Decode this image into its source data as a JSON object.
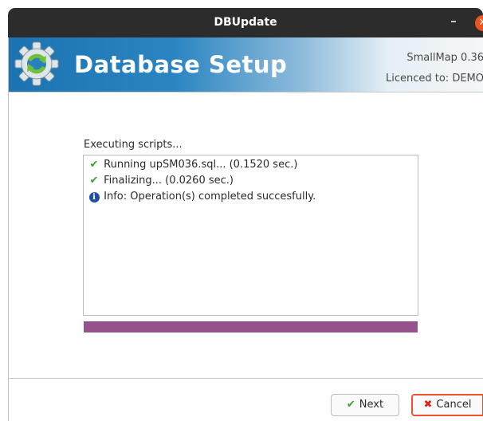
{
  "window": {
    "title": "DBUpdate",
    "minimize_glyph": "–",
    "close_glyph": "✕"
  },
  "header": {
    "title": "Database Setup",
    "product": "SmallMap 0.36",
    "licence": "Licenced to: DEMO",
    "logo_icon": "gear-refresh-icon"
  },
  "main": {
    "section_label": "Executing scripts...",
    "log": [
      {
        "icon": "check-icon",
        "glyph": "✔",
        "text": "Running upSM036.sql... (0.1520 sec.)"
      },
      {
        "icon": "check-icon",
        "glyph": "✔",
        "text": "Finalizing... (0.0260 sec.)"
      },
      {
        "icon": "info-icon",
        "glyph": "i",
        "text": "Info: Operation(s) completed succesfully."
      }
    ],
    "progress": 1.0
  },
  "footer": {
    "next_label": "Next",
    "next_glyph": "✔",
    "cancel_label": "Cancel",
    "cancel_glyph": "✖"
  },
  "colors": {
    "banner_blue": "#1b73b2",
    "progress": "#95538d",
    "success": "#3aa02f",
    "danger": "#d8261a",
    "close_button": "#e95420"
  }
}
